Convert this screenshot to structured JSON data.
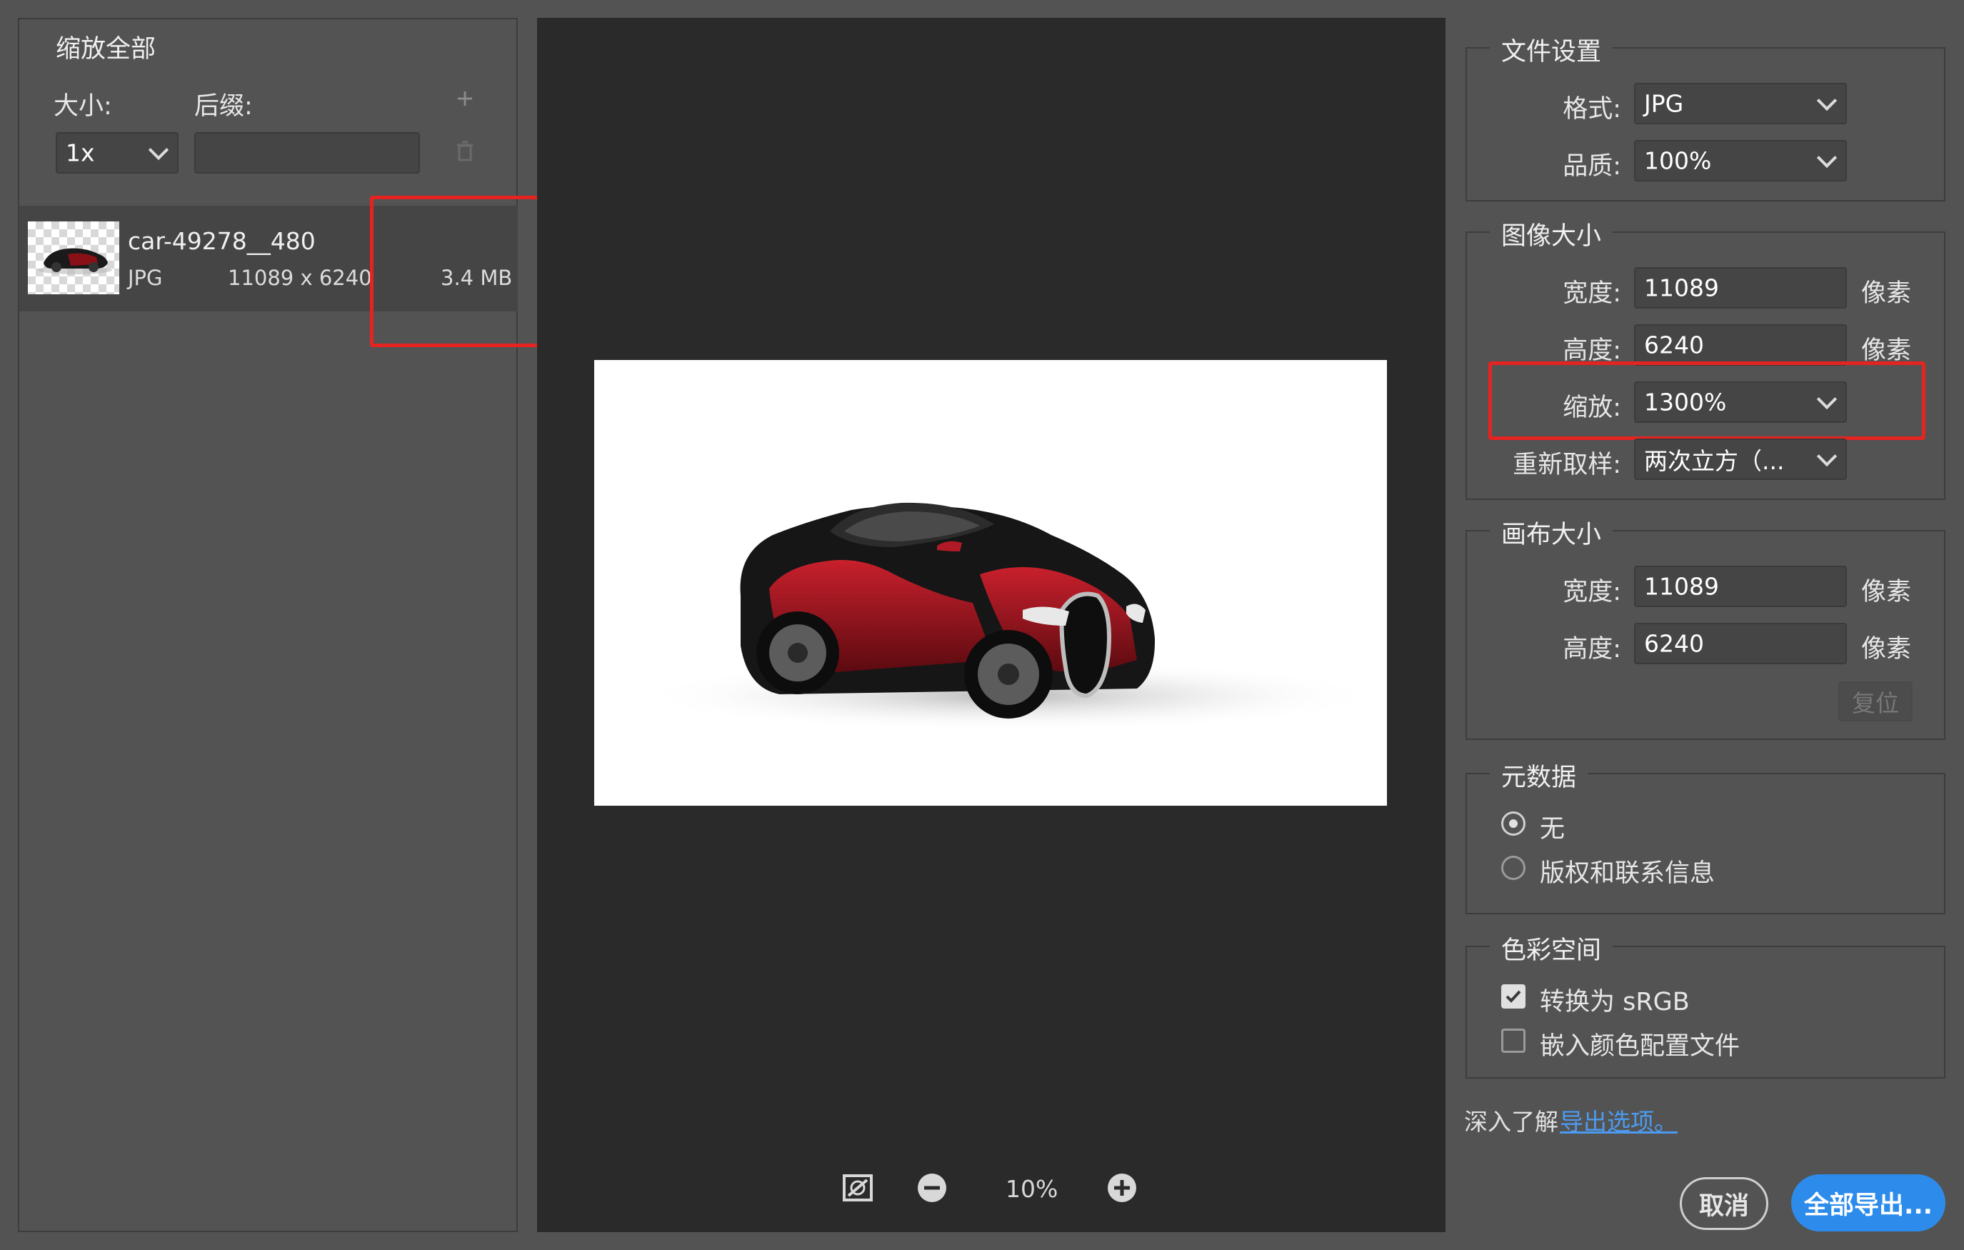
{
  "left_panel": {
    "title": "缩放全部",
    "size_label": "大小:",
    "suffix_label": "后缀:",
    "size_value": "1x",
    "suffix_value": "",
    "add_icon": "plus-icon",
    "delete_icon": "trash-icon"
  },
  "file": {
    "name": "car-49278__480",
    "format": "JPG",
    "dimensions": "11089 x 6240",
    "size": "3.4 MB"
  },
  "preview": {
    "zoom": "10%"
  },
  "file_settings": {
    "title": "文件设置",
    "format_label": "格式:",
    "format_value": "JPG",
    "quality_label": "品质:",
    "quality_value": "100%"
  },
  "image_size": {
    "title": "图像大小",
    "width_label": "宽度:",
    "width_value": "11089",
    "height_label": "高度:",
    "height_value": "6240",
    "scale_label": "缩放:",
    "scale_value": "1300%",
    "resample_label": "重新取样:",
    "resample_value": "两次立方（...",
    "unit": "像素"
  },
  "canvas_size": {
    "title": "画布大小",
    "width_label": "宽度:",
    "width_value": "11089",
    "height_label": "高度:",
    "height_value": "6240",
    "unit": "像素",
    "reset_label": "复位"
  },
  "metadata": {
    "title": "元数据",
    "options": [
      "无",
      "版权和联系信息"
    ],
    "selected": 0
  },
  "color_space": {
    "title": "色彩空间",
    "convert_srgb": "转换为 sRGB",
    "convert_checked": true,
    "embed_profile": "嵌入颜色配置文件",
    "embed_checked": false
  },
  "learn_more": {
    "text": "深入了解",
    "link": "导出选项。"
  },
  "footer": {
    "cancel": "取消",
    "export_all": "全部导出..."
  },
  "colors": {
    "accent": "#2d8ceb",
    "highlight": "#e52421",
    "link": "#4c9bf0"
  }
}
